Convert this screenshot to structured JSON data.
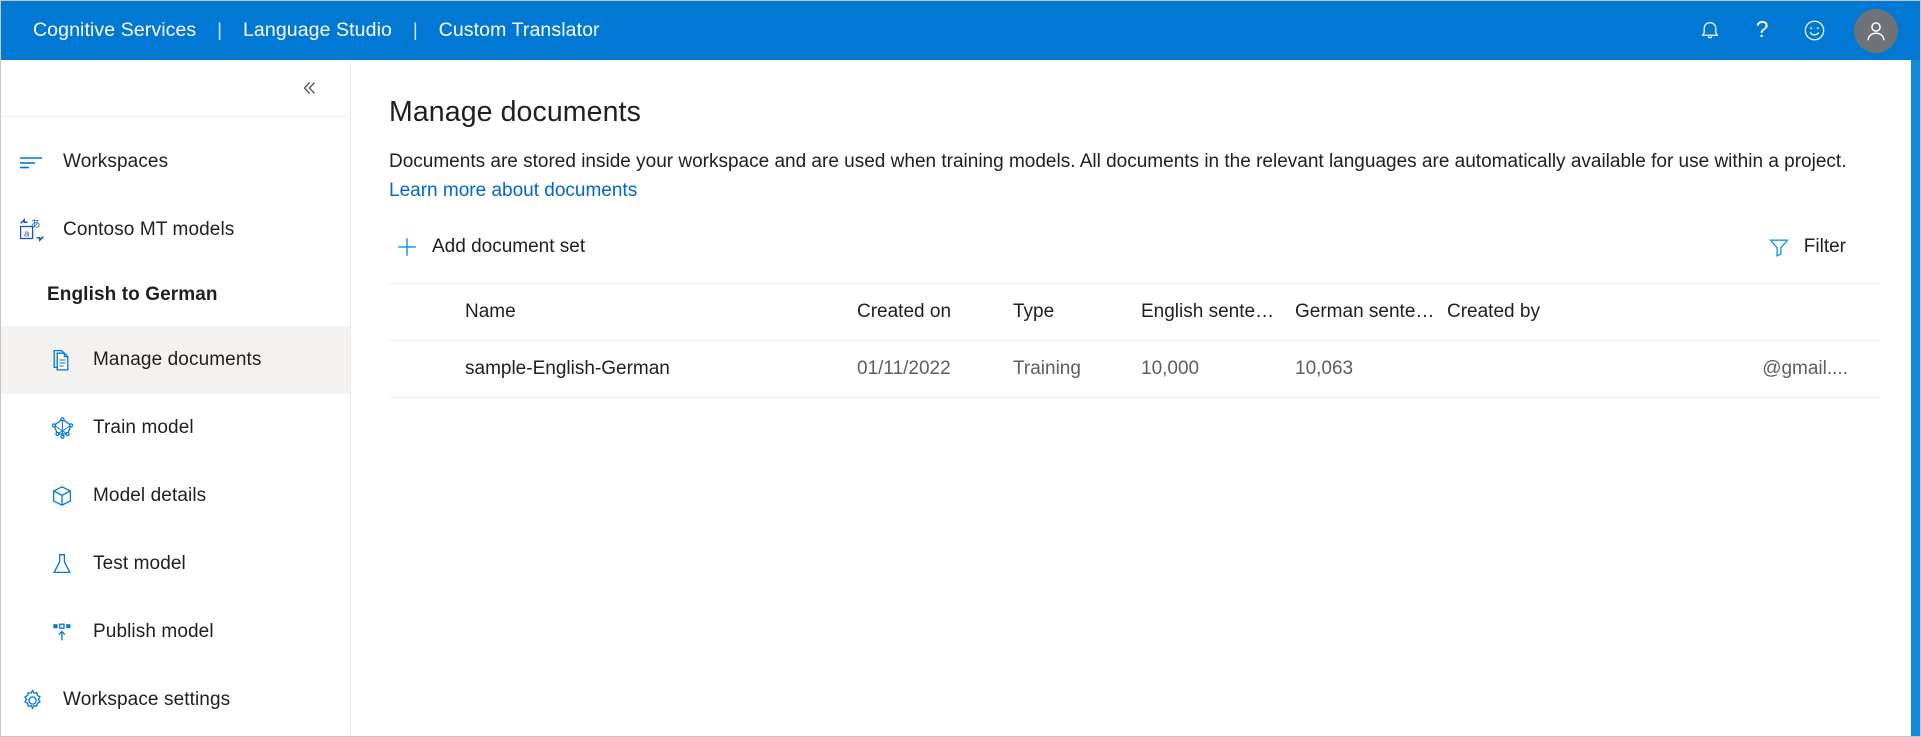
{
  "topbar": {
    "brand": [
      {
        "label": "Cognitive Services"
      },
      {
        "label": "Language Studio"
      },
      {
        "label": "Custom Translator"
      }
    ],
    "separator": "|",
    "icons": [
      {
        "name": "notification-bell-icon",
        "label": "Notifications"
      },
      {
        "name": "help-question-icon",
        "label": "Help"
      },
      {
        "name": "feedback-smiley-icon",
        "label": "Feedback"
      }
    ],
    "avatar": {
      "name": "user-avatar",
      "label": "Account"
    },
    "background_color": "#0078d4"
  },
  "sidebar": {
    "collapse_label": "«",
    "items": [
      {
        "label": "Workspaces",
        "icon": "list-lines-icon",
        "active": false,
        "sub": false
      },
      {
        "label": "Contoso MT models",
        "icon": "translate-icon",
        "active": false,
        "sub": false
      }
    ],
    "group_title": "English to German",
    "sub_items": [
      {
        "label": "Manage documents",
        "icon": "document-icon",
        "active": true
      },
      {
        "label": "Train model",
        "icon": "neural-network-icon",
        "active": false
      },
      {
        "label": "Model details",
        "icon": "package-box-icon",
        "active": false
      },
      {
        "label": "Test model",
        "icon": "flask-icon",
        "active": false
      },
      {
        "label": "Publish model",
        "icon": "publish-upload-icon",
        "active": false
      }
    ],
    "footer_item": {
      "label": "Workspace settings",
      "icon": "gear-icon"
    },
    "accent_color": "#0078d4",
    "active_background": "#f3f2f1"
  },
  "main": {
    "title": "Manage documents",
    "description_part1": "Documents are stored inside your workspace and are used when training models. All documents in the relevant languages are automatically available for use within a project. ",
    "description_link": "Learn more about documents",
    "toolbar": {
      "add_label": "Add document set",
      "add_icon": "plus-icon",
      "filter_label": "Filter",
      "filter_icon": "funnel-filter-icon"
    },
    "table": {
      "columns": [
        "Name",
        "Created on",
        "Type",
        "English sente…",
        "German sente…",
        "Created by"
      ],
      "rows": [
        {
          "name": "sample-English-German",
          "created_on": "01/11/2022",
          "type": "Training",
          "english_sentences": "10,000",
          "german_sentences": "10,063",
          "created_by": "@gmail...."
        }
      ]
    }
  }
}
